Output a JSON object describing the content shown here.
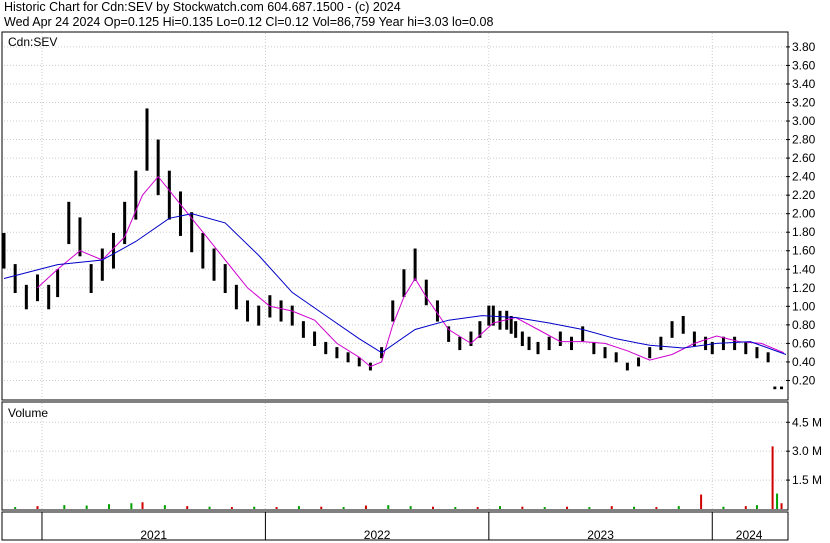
{
  "header": {
    "line1": "Historic Chart for Cdn:SEV by Stockwatch.com 604.687.1500 - (c) 2024",
    "line2": "Wed Apr 24 2024   Op=0.125  Hi=0.135  Lo=0.12  Cl=0.12  Vol=86,759  Year hi=3.03  lo=0.08"
  },
  "chart_data": [
    {
      "type": "line",
      "title": "Cdn:SEV",
      "ylim": [
        0,
        3.95
      ],
      "yticks": [
        0.2,
        0.4,
        0.6,
        0.8,
        1.0,
        1.2,
        1.4,
        1.6,
        1.8,
        2.0,
        2.2,
        2.4,
        2.6,
        2.8,
        3.0,
        3.2,
        3.4,
        3.6,
        3.8
      ],
      "ytick_labels": [
        "0.20",
        "0.40",
        "0.60",
        "0.80",
        "1.00",
        "1.20",
        "1.40",
        "1.60",
        "1.80",
        "2.00",
        "2.20",
        "2.40",
        "2.60",
        "2.80",
        "3.00",
        "3.20",
        "3.40",
        "3.60",
        "3.80"
      ],
      "x_range": [
        2020.83,
        2024.33
      ],
      "grid": true,
      "series": [
        {
          "style": "ohlc-bars",
          "color": "#000000",
          "x": [
            2020.83,
            2020.88,
            2020.93,
            2020.98,
            2021.03,
            2021.07,
            2021.12,
            2021.17,
            2021.22,
            2021.27,
            2021.32,
            2021.37,
            2021.42,
            2021.47,
            2021.52,
            2021.57,
            2021.62,
            2021.67,
            2021.72,
            2021.77,
            2021.82,
            2021.87,
            2021.92,
            2021.97,
            2022.02,
            2022.07,
            2022.12,
            2022.17,
            2022.22,
            2022.27,
            2022.32,
            2022.37,
            2022.42,
            2022.47,
            2022.52,
            2022.57,
            2022.62,
            2022.67,
            2022.72,
            2022.77,
            2022.82,
            2022.87,
            2022.92,
            2022.96,
            2023.0,
            2023.02,
            2023.05,
            2023.08,
            2023.1,
            2023.12,
            2023.15,
            2023.18,
            2023.22,
            2023.27,
            2023.32,
            2023.37,
            2023.42,
            2023.47,
            2023.52,
            2023.57,
            2023.62,
            2023.67,
            2023.72,
            2023.77,
            2023.82,
            2023.87,
            2023.92,
            2023.97,
            2024.0,
            2024.05,
            2024.1,
            2024.15,
            2024.2,
            2024.25,
            2024.28,
            2024.31
          ],
          "values": [
            1.6,
            1.3,
            1.1,
            1.2,
            1.1,
            1.25,
            1.9,
            1.75,
            1.3,
            1.45,
            1.6,
            1.9,
            2.2,
            2.8,
            2.5,
            2.2,
            2.0,
            1.8,
            1.6,
            1.45,
            1.3,
            1.1,
            0.95,
            0.9,
            1.0,
            0.95,
            0.9,
            0.75,
            0.65,
            0.55,
            0.5,
            0.45,
            0.4,
            0.35,
            0.5,
            0.95,
            1.25,
            1.45,
            1.15,
            0.95,
            0.7,
            0.6,
            0.65,
            0.75,
            0.9,
            0.9,
            0.85,
            0.85,
            0.8,
            0.75,
            0.65,
            0.6,
            0.55,
            0.6,
            0.65,
            0.6,
            0.7,
            0.55,
            0.5,
            0.45,
            0.35,
            0.4,
            0.5,
            0.6,
            0.75,
            0.8,
            0.65,
            0.6,
            0.55,
            0.6,
            0.6,
            0.55,
            0.5,
            0.45,
            0.12,
            0.12
          ]
        },
        {
          "name": "",
          "style": "moving-average-short",
          "color": "#d000d0",
          "x": [
            2020.98,
            2021.07,
            2021.17,
            2021.27,
            2021.37,
            2021.45,
            2021.52,
            2021.62,
            2021.72,
            2021.82,
            2021.92,
            2022.02,
            2022.12,
            2022.22,
            2022.32,
            2022.42,
            2022.47,
            2022.52,
            2022.57,
            2022.62,
            2022.67,
            2022.72,
            2022.82,
            2022.92,
            2023.02,
            2023.12,
            2023.22,
            2023.32,
            2023.42,
            2023.52,
            2023.62,
            2023.72,
            2023.82,
            2023.92,
            2024.02,
            2024.12,
            2024.22,
            2024.32
          ],
          "values": [
            1.2,
            1.4,
            1.6,
            1.5,
            1.75,
            2.2,
            2.4,
            2.1,
            1.8,
            1.5,
            1.2,
            1.0,
            0.95,
            0.85,
            0.6,
            0.45,
            0.35,
            0.4,
            0.8,
            1.1,
            1.3,
            1.1,
            0.75,
            0.6,
            0.82,
            0.88,
            0.75,
            0.62,
            0.62,
            0.6,
            0.52,
            0.42,
            0.48,
            0.6,
            0.68,
            0.62,
            0.6,
            0.5
          ]
        },
        {
          "name": "",
          "style": "moving-average-long",
          "color": "#0000c8",
          "x": [
            2020.83,
            2021.07,
            2021.27,
            2021.42,
            2021.57,
            2021.67,
            2021.82,
            2021.97,
            2022.12,
            2022.27,
            2022.42,
            2022.52,
            2022.67,
            2022.82,
            2022.97,
            2023.12,
            2023.27,
            2023.42,
            2023.57,
            2023.72,
            2023.87,
            2024.02,
            2024.17,
            2024.33
          ],
          "values": [
            1.3,
            1.45,
            1.5,
            1.7,
            1.95,
            2.0,
            1.9,
            1.55,
            1.15,
            0.9,
            0.65,
            0.5,
            0.75,
            0.85,
            0.9,
            0.88,
            0.82,
            0.75,
            0.65,
            0.58,
            0.55,
            0.6,
            0.62,
            0.48
          ]
        }
      ]
    },
    {
      "type": "bar",
      "title": "Volume",
      "ylim": [
        0,
        5.5
      ],
      "yticks": [
        1.5,
        3.0,
        4.5
      ],
      "ytick_labels": [
        "1.5 M",
        "3.0 M",
        "4.5 M"
      ],
      "x_range": [
        2020.83,
        2024.33
      ],
      "xtick_labels": [
        "2021",
        "2022",
        "2023",
        "2024"
      ],
      "year_boundaries": [
        2021.0,
        2022.0,
        2023.0,
        2024.0
      ],
      "colors": {
        "up": "#00a000",
        "down": "#d00000",
        "flat": "#000000"
      },
      "series": [
        {
          "name": "",
          "x": [
            2020.88,
            2020.98,
            2021.1,
            2021.2,
            2021.3,
            2021.4,
            2021.45,
            2021.55,
            2021.65,
            2021.75,
            2021.85,
            2021.95,
            2022.05,
            2022.15,
            2022.25,
            2022.35,
            2022.45,
            2022.55,
            2022.65,
            2022.75,
            2022.85,
            2022.95,
            2023.05,
            2023.15,
            2023.25,
            2023.35,
            2023.45,
            2023.55,
            2023.65,
            2023.75,
            2023.85,
            2023.95,
            2024.05,
            2024.15,
            2024.2,
            2024.27,
            2024.29,
            2024.31
          ],
          "values": [
            0.1,
            0.15,
            0.2,
            0.18,
            0.25,
            0.3,
            0.35,
            0.2,
            0.15,
            0.12,
            0.1,
            0.12,
            0.1,
            0.15,
            0.12,
            0.1,
            0.18,
            0.2,
            0.15,
            0.12,
            0.1,
            0.1,
            0.15,
            0.12,
            0.1,
            0.12,
            0.1,
            0.15,
            0.12,
            0.1,
            0.15,
            0.75,
            0.12,
            0.15,
            0.2,
            3.25,
            0.8,
            0.3
          ],
          "direction": [
            "up",
            "down",
            "up",
            "up",
            "up",
            "up",
            "down",
            "up",
            "down",
            "up",
            "down",
            "up",
            "down",
            "up",
            "down",
            "up",
            "down",
            "up",
            "up",
            "down",
            "up",
            "down",
            "up",
            "down",
            "up",
            "down",
            "up",
            "down",
            "up",
            "down",
            "up",
            "down",
            "up",
            "down",
            "up",
            "down",
            "up",
            "down"
          ]
        }
      ]
    }
  ]
}
